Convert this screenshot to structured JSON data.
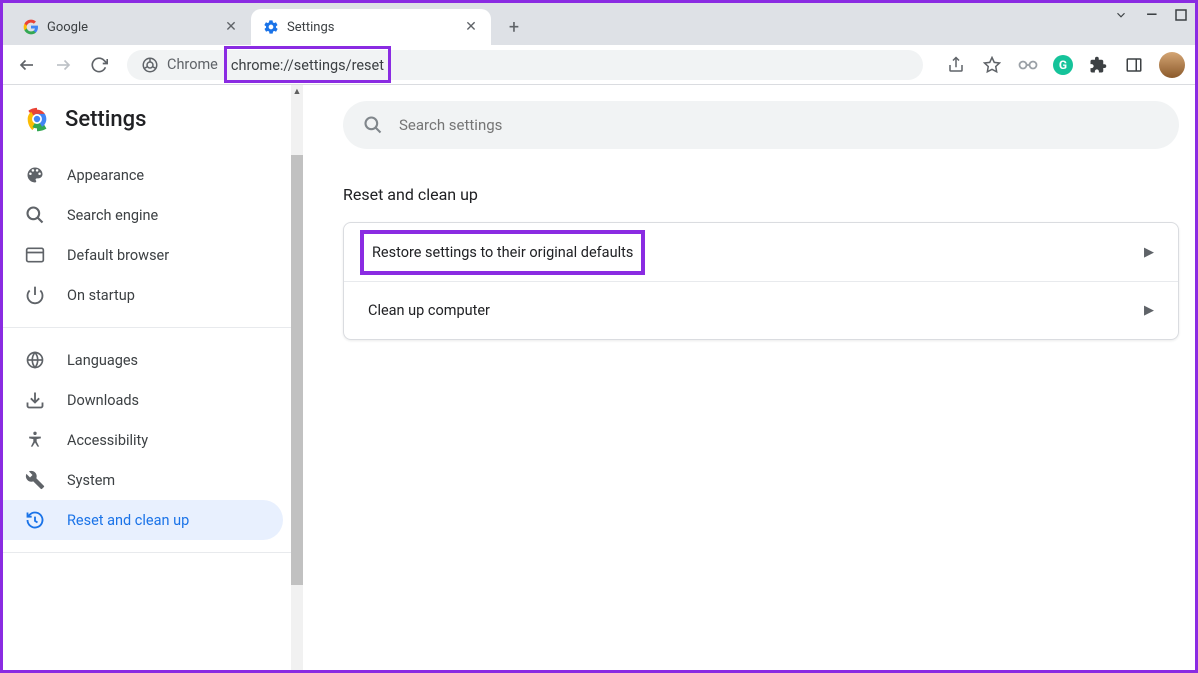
{
  "tabs": [
    {
      "title": "Google",
      "favicon": "google"
    },
    {
      "title": "Settings",
      "favicon": "gear"
    }
  ],
  "address": {
    "site_label": "Chrome",
    "url": "chrome://settings/reset"
  },
  "settings_title": "Settings",
  "search": {
    "placeholder": "Search settings"
  },
  "nav_items_top": [
    {
      "icon": "palette",
      "label": "Appearance"
    },
    {
      "icon": "search",
      "label": "Search engine"
    },
    {
      "icon": "browser",
      "label": "Default browser"
    },
    {
      "icon": "power",
      "label": "On startup"
    }
  ],
  "nav_items_bottom": [
    {
      "icon": "globe",
      "label": "Languages"
    },
    {
      "icon": "download",
      "label": "Downloads"
    },
    {
      "icon": "accessibility",
      "label": "Accessibility"
    },
    {
      "icon": "wrench",
      "label": "System"
    },
    {
      "icon": "restore",
      "label": "Reset and clean up",
      "selected": true
    }
  ],
  "section_title": "Reset and clean up",
  "card_rows": [
    {
      "label": "Restore settings to their original defaults",
      "highlight": true
    },
    {
      "label": "Clean up computer"
    }
  ]
}
